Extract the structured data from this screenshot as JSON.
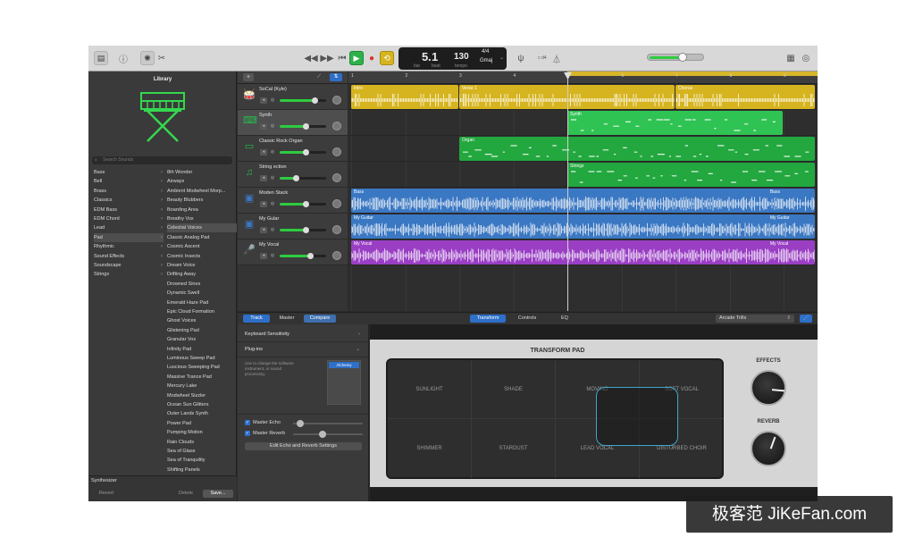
{
  "toolbar": {
    "lcd": {
      "bar": "5",
      "beat": "1",
      "bar_label": "bar",
      "beat_label": "beat",
      "tempo": "130",
      "tempo_label": "tempo",
      "time_sig": "4/4",
      "key": "Gmaj"
    },
    "tuner_label": "c d4"
  },
  "library": {
    "title": "Library",
    "search_placeholder": "Search Sounds",
    "categories": [
      "Bass",
      "Bell",
      "Brass",
      "Classics",
      "EDM Bass",
      "EDM Chord",
      "Lead",
      "Pad",
      "Rhythmic",
      "Sound Effects",
      "Soundscape",
      "Strings"
    ],
    "selected_category": "Pad",
    "patches": [
      "8th Wonder",
      "Airways",
      "Ambient Modwheel Morp...",
      "Beauty Blubbers",
      "Boarding Area",
      "Breathy Vox",
      "Celestial Voices",
      "Classic Analog Pad",
      "Cosmic Ascent",
      "Cosmic Insects",
      "Dream Voice",
      "Drifting Away",
      "Drowned Sines",
      "Dynamic Swell",
      "Emerald Haze Pad",
      "Epic Cloud Formation",
      "Ghost Voices",
      "Glistening Pad",
      "Granular Vox",
      "Infinity Pad",
      "Luminous Sweep Pad",
      "Luscious Sweeping Pad",
      "Massive Trance Pad",
      "Mercury Lake",
      "Modwheel Sizzler",
      "Ocean Sun Glitters",
      "Outer Lands Synth",
      "Power Pad",
      "Pumping Motion",
      "Rain Clouds",
      "Sea of Glass",
      "Sea of Tranquility",
      "Shifting Panels"
    ],
    "selected_patch": "Celestial Voices",
    "footer_label": "Synthesizer",
    "revert": "Revert",
    "delete": "Delete",
    "save": "Save..."
  },
  "tracks": [
    {
      "name": "SoCal (Kyle)",
      "icon": "drummer-icon",
      "color": "#d6b41f",
      "volume": 0.75
    },
    {
      "name": "Synth",
      "icon": "keyboard-icon",
      "color": "#27b94a",
      "volume": 0.55
    },
    {
      "name": "Classic Rock Organ",
      "icon": "organ-icon",
      "color": "#27b94a",
      "volume": 0.55
    },
    {
      "name": "String ection",
      "icon": "strings-icon",
      "color": "#27b94a",
      "volume": 0.35
    },
    {
      "name": "Moden Stack",
      "icon": "amp-icon",
      "color": "#3b78c3",
      "volume": 0.55
    },
    {
      "name": "My Gular",
      "icon": "amp-icon",
      "color": "#3b78c3",
      "volume": 0.55
    },
    {
      "name": "My Vocal",
      "icon": "mic-icon",
      "color": "#9a3fc4",
      "volume": 0.65
    }
  ],
  "ruler": [
    "1",
    "2",
    "3",
    "4",
    "5",
    "6",
    "7",
    "8",
    "9"
  ],
  "regions": [
    {
      "lane": 0,
      "label": "Intro",
      "bar_start": 1,
      "bar_end": 3,
      "color": "#d6b41f"
    },
    {
      "lane": 0,
      "label": "Verse 1",
      "bar_start": 3,
      "bar_end": 7,
      "color": "#d6b41f"
    },
    {
      "lane": 0,
      "label": "Chorus",
      "bar_start": 7,
      "bar_end": 9.6,
      "color": "#d6b41f"
    },
    {
      "lane": 1,
      "label": "Synth",
      "bar_start": 5,
      "bar_end": 9,
      "color": "#2fc353"
    },
    {
      "lane": 2,
      "label": "Organ",
      "bar_start": 3,
      "bar_end": 9.6,
      "color": "#22a83f"
    },
    {
      "lane": 3,
      "label": "Strings",
      "bar_start": 5,
      "bar_end": 9.6,
      "color": "#22a83f"
    },
    {
      "lane": 4,
      "label": "Bass",
      "bar_start": 1,
      "bar_end": 9.6,
      "color": "#3b78c3"
    },
    {
      "lane": 4,
      "label": "Bass",
      "bar_start": 8.7,
      "bar_end": 9.6,
      "color": "#3b78c3"
    },
    {
      "lane": 5,
      "label": "My Guitar",
      "bar_start": 1,
      "bar_end": 9.6,
      "color": "#3b78c3"
    },
    {
      "lane": 5,
      "label": "My Guitar",
      "bar_start": 8.7,
      "bar_end": 9.6,
      "color": "#3b78c3"
    },
    {
      "lane": 6,
      "label": "My Vocal",
      "bar_start": 1,
      "bar_end": 9.6,
      "color": "#9a3fc4"
    },
    {
      "lane": 6,
      "label": "My Vocal",
      "bar_start": 8.7,
      "bar_end": 9.6,
      "color": "#9a3fc4"
    }
  ],
  "playhead_bar": 5,
  "editor": {
    "tabs": [
      "Track",
      "Master",
      "Compare"
    ],
    "modes": [
      "Transform",
      "Controls",
      "EQ"
    ],
    "arpeggiator": "Arcade Trills"
  },
  "smart_controls": {
    "keyboard_sensitivity": "Keyboard Sensitivity",
    "plugins": "Plug-ins",
    "plugin_hint": "Use to change the software instrument, or sound processing.",
    "plugin_name": "Alchemy",
    "master_echo": "Master Echo",
    "master_reverb": "Master Reverb",
    "master_echo_level": 0.1,
    "master_reverb_level": 0.42,
    "edit_button": "Edit Echo and Reverb Settings"
  },
  "transform_pad": {
    "title": "TRANSFORM PAD",
    "cells": [
      "SUNLIGHT",
      "SHADE",
      "MOVING",
      "SOFT VOCAL",
      "SHIMMER",
      "STARDUST",
      "LEAD VOCAL",
      "DISTURBED CHOIR"
    ],
    "effects_label": "EFFECTS",
    "reverb_label": "REVERB"
  },
  "watermark": "极客范 JiKeFan.com"
}
